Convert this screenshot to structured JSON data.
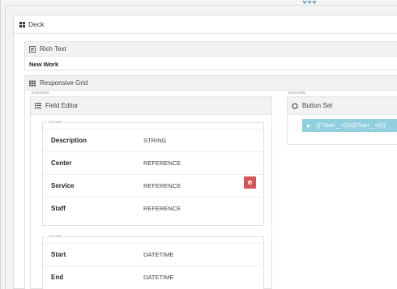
{
  "deck": {
    "title": "Deck"
  },
  "rich_text": {
    "title": "Rich Text",
    "content": "New Work"
  },
  "responsive_grid": {
    "title": "Responsive Grid"
  },
  "labels": {
    "division": "DIVISION",
    "column": "COLUMN"
  },
  "field_editor": {
    "title": "Field Editor",
    "columns": [
      {
        "rows": [
          {
            "name": "Description",
            "type": "STRING"
          },
          {
            "name": "Center",
            "type": "REFERENCE"
          },
          {
            "name": "Service",
            "type": "REFERENCE"
          },
          {
            "name": "Staff",
            "type": "REFERENCE"
          }
        ]
      },
      {
        "rows": [
          {
            "name": "Start",
            "type": "DATETIME"
          },
          {
            "name": "End",
            "type": "DATETIME"
          }
        ]
      }
    ]
  },
  "button_set": {
    "title": "Button Set",
    "button_label": "{{^Start__c}}S{{/Start__c}}{{"
  },
  "colors": {
    "delete": "#d65656",
    "button": "#8ecfe0"
  }
}
